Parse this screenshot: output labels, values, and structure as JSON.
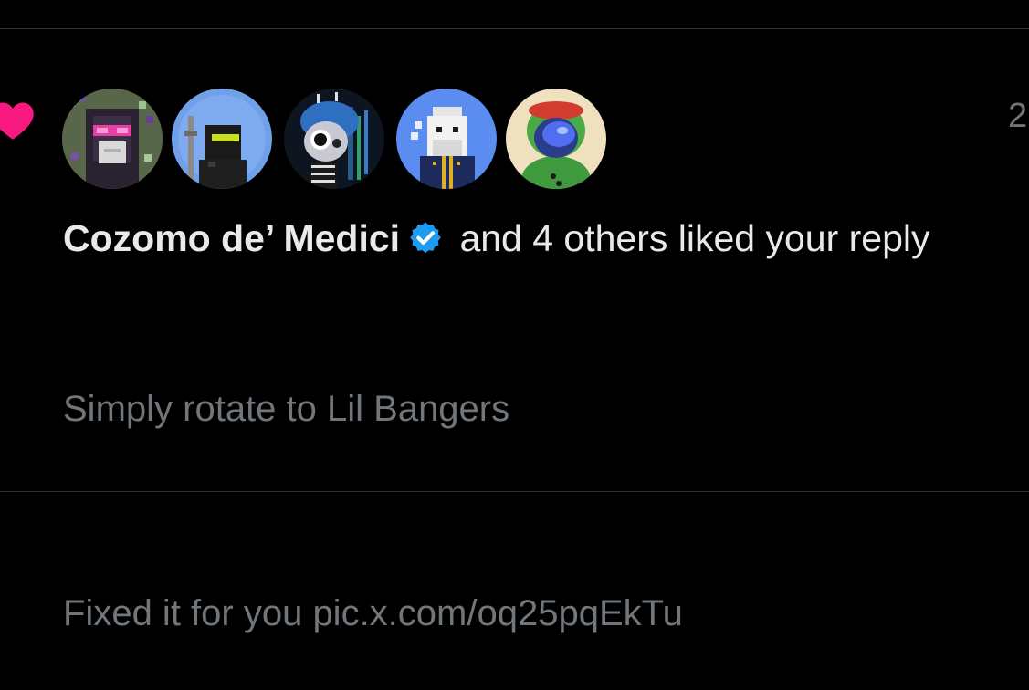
{
  "notification": {
    "type_icon": "heart-icon",
    "timestamp": "2",
    "actor_name": "Cozomo de’ Medici",
    "verified_icon": "verified-badge-icon",
    "action_text": " and 4 others liked your reply",
    "reply_line_1": "Simply rotate to Lil Bangers",
    "reply_line_2": "Fixed it for you pic.x.com/oq25pqEkTu",
    "avatars": [
      {
        "name": "avatar-cozomo-de-medici",
        "bg": "#6c7a5a"
      },
      {
        "name": "avatar-pixel-soldier",
        "bg": "#6fa0e8"
      },
      {
        "name": "avatar-punk-cartoon",
        "bg": "#1a2a3a"
      },
      {
        "name": "avatar-pixel-white-hood",
        "bg": "#5b8cf0"
      },
      {
        "name": "avatar-frog-hood",
        "bg": "#efe0bf"
      }
    ]
  },
  "colors": {
    "background": "#000000",
    "primary_text": "#e7e9ea",
    "secondary_text": "#71767b",
    "like_pink": "#f91880",
    "verified_blue": "#1d9bf0",
    "divider": "#2f3336"
  }
}
